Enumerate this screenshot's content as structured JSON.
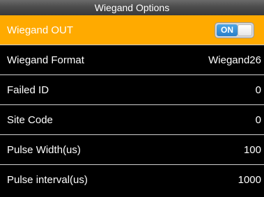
{
  "header": {
    "title": "Wiegand Options"
  },
  "menu": {
    "wiegand_out": {
      "label": "Wiegand OUT",
      "toggle_text": "ON"
    },
    "items": [
      {
        "label": "Wiegand Format",
        "value": "Wiegand26"
      },
      {
        "label": "Failed ID",
        "value": "0"
      },
      {
        "label": "Site Code",
        "value": "0"
      },
      {
        "label": "Pulse Width(us)",
        "value": "100"
      },
      {
        "label": "Pulse interval(us)",
        "value": "1000"
      }
    ]
  },
  "colors": {
    "selected_row": "#ffaa00",
    "background": "#000000",
    "toggle_on": "#2a7fc9"
  }
}
